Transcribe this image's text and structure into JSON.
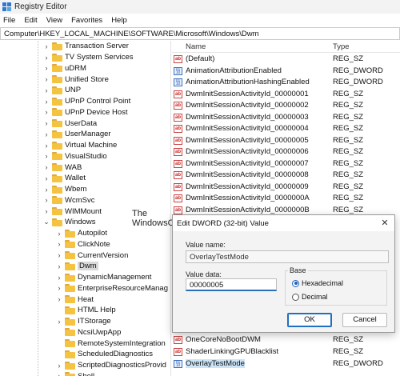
{
  "window": {
    "title": "Registry Editor"
  },
  "menu": [
    "File",
    "Edit",
    "View",
    "Favorites",
    "Help"
  ],
  "address": "Computer\\HKEY_LOCAL_MACHINE\\SOFTWARE\\Microsoft\\Windows\\Dwm",
  "tree": [
    {
      "label": "Transaction Server",
      "expanded": false,
      "level": 0
    },
    {
      "label": "TV System Services",
      "expanded": false,
      "level": 0
    },
    {
      "label": "uDRM",
      "expanded": false,
      "level": 0
    },
    {
      "label": "Unified Store",
      "expanded": false,
      "level": 0
    },
    {
      "label": "UNP",
      "expanded": false,
      "level": 0
    },
    {
      "label": "UPnP Control Point",
      "expanded": false,
      "level": 0
    },
    {
      "label": "UPnP Device Host",
      "expanded": false,
      "level": 0
    },
    {
      "label": "UserData",
      "expanded": false,
      "level": 0
    },
    {
      "label": "UserManager",
      "expanded": false,
      "level": 0
    },
    {
      "label": "Virtual Machine",
      "expanded": false,
      "level": 0
    },
    {
      "label": "VisualStudio",
      "expanded": false,
      "level": 0
    },
    {
      "label": "WAB",
      "expanded": false,
      "level": 0
    },
    {
      "label": "Wallet",
      "expanded": false,
      "level": 0
    },
    {
      "label": "Wbem",
      "expanded": false,
      "level": 0
    },
    {
      "label": "WcmSvc",
      "expanded": false,
      "level": 0
    },
    {
      "label": "WIMMount",
      "expanded": false,
      "level": 0
    },
    {
      "label": "Windows",
      "expanded": true,
      "level": 0
    },
    {
      "label": "Autopilot",
      "expanded": false,
      "level": 1
    },
    {
      "label": "ClickNote",
      "expanded": false,
      "level": 1
    },
    {
      "label": "CurrentVersion",
      "expanded": false,
      "level": 1
    },
    {
      "label": "Dwm",
      "expanded": false,
      "level": 1,
      "selected": true
    },
    {
      "label": "DynamicManagement",
      "expanded": false,
      "level": 1
    },
    {
      "label": "EnterpriseResourceManag",
      "expanded": false,
      "level": 1
    },
    {
      "label": "Heat",
      "expanded": false,
      "level": 1
    },
    {
      "label": "HTML Help",
      "expanded": false,
      "level": 1,
      "leaf": true
    },
    {
      "label": "ITStorage",
      "expanded": false,
      "level": 1
    },
    {
      "label": "NcsiUwpApp",
      "expanded": false,
      "level": 1,
      "leaf": true
    },
    {
      "label": "RemoteSystemIntegration",
      "expanded": false,
      "level": 1,
      "leaf": true
    },
    {
      "label": "ScheduledDiagnostics",
      "expanded": false,
      "level": 1,
      "leaf": true
    },
    {
      "label": "ScriptedDiagnosticsProvid",
      "expanded": false,
      "level": 1
    },
    {
      "label": "Shell",
      "expanded": false,
      "level": 1
    }
  ],
  "list": {
    "headers": {
      "name": "Name",
      "type": "Type"
    },
    "rows": [
      {
        "name": "(Default)",
        "type": "REG_SZ",
        "icon": "string-value-icon"
      },
      {
        "name": "AnimationAttributionEnabled",
        "type": "REG_DWORD",
        "icon": "binary-value-icon"
      },
      {
        "name": "AnimationAttributionHashingEnabled",
        "type": "REG_DWORD",
        "icon": "binary-value-icon"
      },
      {
        "name": "DwmInitSessionActivityId_00000001",
        "type": "REG_SZ",
        "icon": "string-value-icon"
      },
      {
        "name": "DwmInitSessionActivityId_00000002",
        "type": "REG_SZ",
        "icon": "string-value-icon"
      },
      {
        "name": "DwmInitSessionActivityId_00000003",
        "type": "REG_SZ",
        "icon": "string-value-icon"
      },
      {
        "name": "DwmInitSessionActivityId_00000004",
        "type": "REG_SZ",
        "icon": "string-value-icon"
      },
      {
        "name": "DwmInitSessionActivityId_00000005",
        "type": "REG_SZ",
        "icon": "string-value-icon"
      },
      {
        "name": "DwmInitSessionActivityId_00000006",
        "type": "REG_SZ",
        "icon": "string-value-icon"
      },
      {
        "name": "DwmInitSessionActivityId_00000007",
        "type": "REG_SZ",
        "icon": "string-value-icon"
      },
      {
        "name": "DwmInitSessionActivityId_00000008",
        "type": "REG_SZ",
        "icon": "string-value-icon"
      },
      {
        "name": "DwmInitSessionActivityId_00000009",
        "type": "REG_SZ",
        "icon": "string-value-icon"
      },
      {
        "name": "DwmInitSessionActivityId_0000000A",
        "type": "REG_SZ",
        "icon": "string-value-icon"
      },
      {
        "name": "DwmInitSessionActivityId_0000000B",
        "type": "REG_SZ",
        "icon": "string-value-icon"
      }
    ],
    "bottom_rows": [
      {
        "name": "OneCoreNoBootDWM",
        "type": "REG_SZ",
        "icon": "string-value-icon"
      },
      {
        "name": "ShaderLinkingGPUBlacklist",
        "type": "REG_SZ",
        "icon": "string-value-icon"
      },
      {
        "name": "OverlayTestMode",
        "type": "REG_DWORD",
        "icon": "binary-value-icon",
        "selected": true
      }
    ]
  },
  "watermark": {
    "line1": "The",
    "line2": "WindowsClub"
  },
  "dialog": {
    "title": "Edit DWORD (32-bit) Value",
    "value_name_label": "Value name:",
    "value_name": "OverlayTestMode",
    "value_data_label": "Value data:",
    "value_data": "00000005",
    "base_label": "Base",
    "base_options": [
      {
        "label": "Hexadecimal",
        "selected": true
      },
      {
        "label": "Decimal",
        "selected": false
      }
    ],
    "ok_label": "OK",
    "cancel_label": "Cancel"
  }
}
